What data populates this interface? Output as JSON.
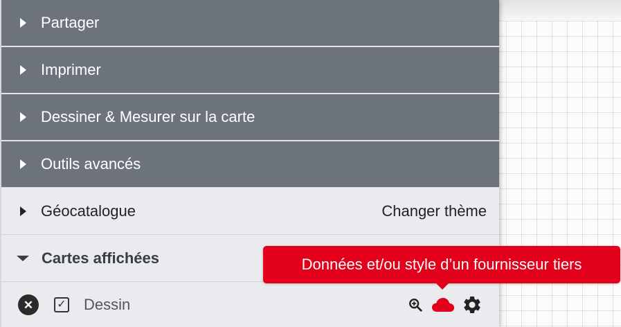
{
  "menu": {
    "items": [
      {
        "label": "Partager"
      },
      {
        "label": "Imprimer"
      },
      {
        "label": "Dessiner & Mesurer sur la carte"
      },
      {
        "label": "Outils avancés"
      }
    ],
    "geocatalogue": {
      "label": "Géocatalogue",
      "action": "Changer thème"
    },
    "cartes": {
      "label": "Cartes affichées"
    }
  },
  "layer": {
    "name": "Dessin",
    "checked": true
  },
  "tooltip": {
    "text": "Données et/ou style d’un fournisseur tiers"
  },
  "colors": {
    "menu_dark": "#6c737c",
    "panel_light": "#e9ebee",
    "third_party_red": "#e2001a"
  },
  "icons": {
    "close": "close-icon",
    "checkbox": "checkbox-checked-icon",
    "zoom": "zoom-in-icon",
    "cloud": "cloud-icon",
    "settings": "gear-icon"
  }
}
